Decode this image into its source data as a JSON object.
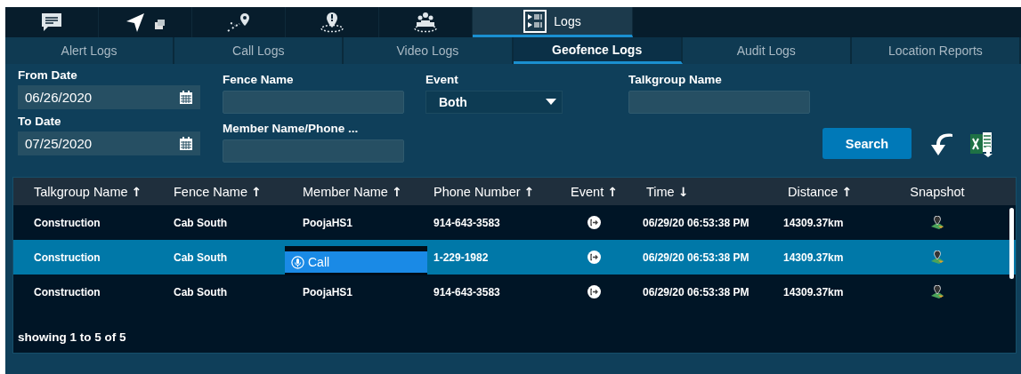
{
  "top_tabs": [
    {
      "kind": "chat",
      "selected": false
    },
    {
      "kind": "navigate",
      "selected": false
    },
    {
      "kind": "route",
      "selected": false
    },
    {
      "kind": "geofence",
      "selected": false
    },
    {
      "kind": "group",
      "selected": false
    },
    {
      "kind": "logs",
      "label": "Logs",
      "selected": true
    }
  ],
  "sub_tabs": [
    {
      "label": "Alert Logs",
      "selected": false
    },
    {
      "label": "Call Logs",
      "selected": false
    },
    {
      "label": "Video Logs",
      "selected": false
    },
    {
      "label": "Geofence Logs",
      "selected": true
    },
    {
      "label": "Audit Logs",
      "selected": false
    },
    {
      "label": "Location Reports",
      "selected": false
    }
  ],
  "filters": {
    "from_date": {
      "label": "From Date",
      "value": "06/26/2020"
    },
    "to_date": {
      "label": "To Date",
      "value": "07/25/2020"
    },
    "fence_name": {
      "label": "Fence Name"
    },
    "member": {
      "label": "Member Name/Phone ..."
    },
    "event": {
      "label": "Event",
      "value": "Both"
    },
    "talkgroup": {
      "label": "Talkgroup Name"
    },
    "search_button": "Search"
  },
  "table": {
    "columns": [
      {
        "label": "Talkgroup Name",
        "sort_arrow": "↑"
      },
      {
        "label": "Fence Name",
        "sort_arrow": "↑"
      },
      {
        "label": "Member Name",
        "sort_arrow": "↑"
      },
      {
        "label": "Phone Number",
        "sort_arrow": "↑"
      },
      {
        "label": "Event",
        "sort_arrow": "↑"
      },
      {
        "label": "Time",
        "sort_arrow": "↓"
      },
      {
        "label": "Distance",
        "sort_arrow": "↑"
      },
      {
        "label": "Snapshot"
      }
    ],
    "rows": [
      {
        "talkgroup": "Construction",
        "fence": "Cab South",
        "member": "PoojaHS1",
        "phone": "914-643-3583",
        "time": "06/29/20 06:53:38 PM",
        "distance": "14309.37km",
        "selected": false
      },
      {
        "talkgroup": "Construction",
        "fence": "Cab South",
        "phone": "1-229-1982",
        "time": "06/29/20 06:53:38 PM",
        "distance": "14309.37km",
        "selected": true
      },
      {
        "talkgroup": "Construction",
        "fence": "Cab South",
        "member": "PoojaHS1",
        "phone": "914-643-3583",
        "time": "06/29/20 06:53:38 PM",
        "distance": "14309.37km",
        "selected": false
      }
    ],
    "footer": "showing 1 to 5 of 5"
  },
  "context_menu": {
    "items": [
      "Call"
    ]
  }
}
